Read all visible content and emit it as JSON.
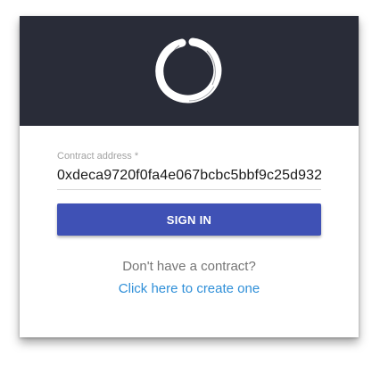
{
  "header": {
    "logo_icon": "enso-circle-logo",
    "background": "#292c38"
  },
  "form": {
    "contract_label": "Contract address *",
    "contract_value": "0xdeca9720f0fa4e067bcbc5bbf9c25d932",
    "signin_label": "SIGN IN",
    "signin_color": "#3f51b5"
  },
  "footer": {
    "prompt": "Don't have a contract?",
    "link": "Click here to create one",
    "link_color": "#2f8fd8"
  }
}
